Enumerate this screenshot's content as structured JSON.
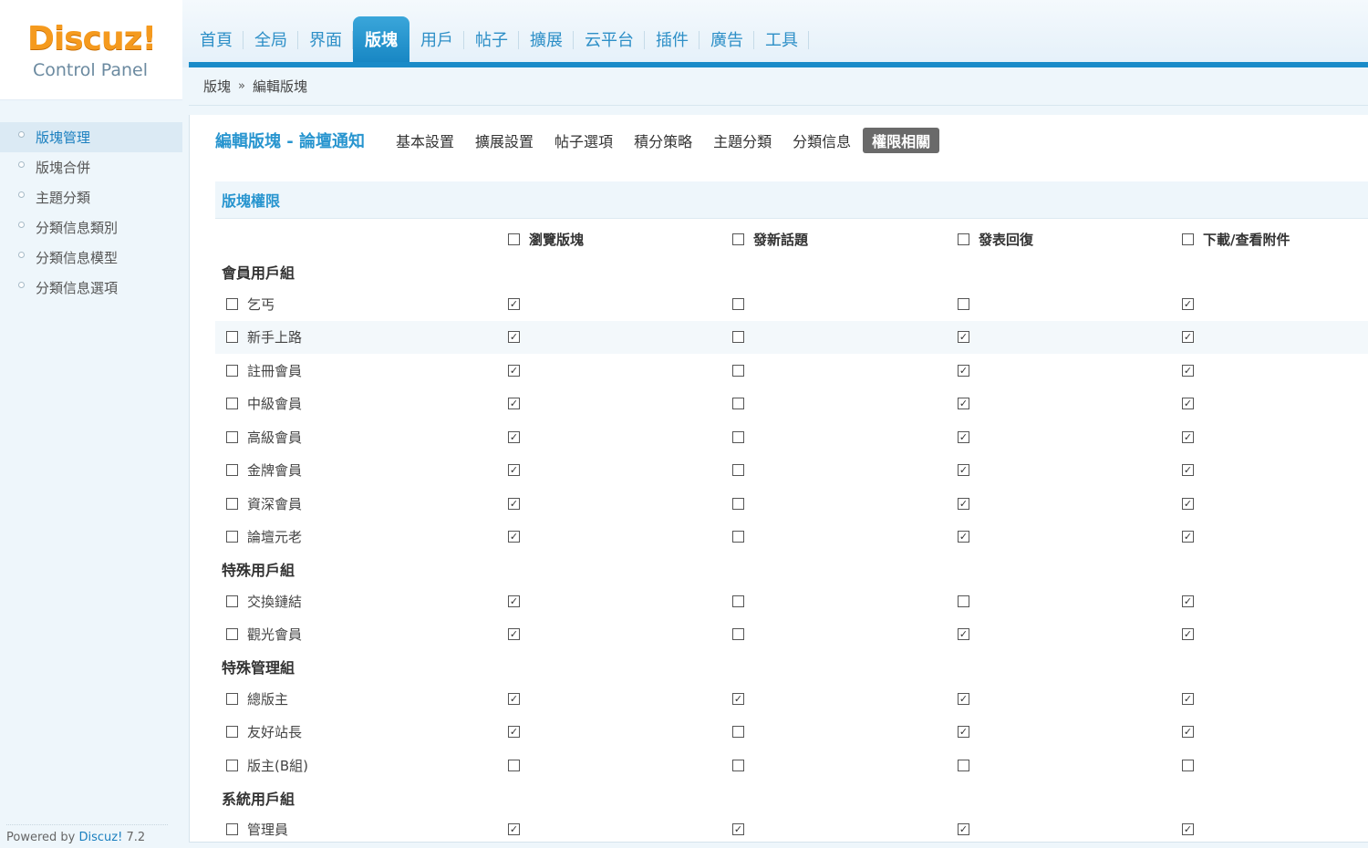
{
  "logo": {
    "word": "Discuz!",
    "sub": "Control Panel"
  },
  "nav": [
    {
      "label": "首頁",
      "active": false
    },
    {
      "label": "全局",
      "active": false
    },
    {
      "label": "界面",
      "active": false
    },
    {
      "label": "版塊",
      "active": true
    },
    {
      "label": "用戶",
      "active": false
    },
    {
      "label": "帖子",
      "active": false
    },
    {
      "label": "擴展",
      "active": false
    },
    {
      "label": "云平台",
      "active": false
    },
    {
      "label": "插件",
      "active": false
    },
    {
      "label": "廣告",
      "active": false
    },
    {
      "label": "工具",
      "active": false
    }
  ],
  "breadcrumb": {
    "root": "版塊",
    "separator": "»",
    "current": "編輯版塊"
  },
  "sidebar": {
    "items": [
      {
        "label": "版塊管理",
        "active": true
      },
      {
        "label": "版塊合併",
        "active": false
      },
      {
        "label": "主題分類",
        "active": false
      },
      {
        "label": "分類信息類別",
        "active": false
      },
      {
        "label": "分類信息模型",
        "active": false
      },
      {
        "label": "分類信息選項",
        "active": false
      }
    ],
    "powered_prefix": "Powered by",
    "powered_brand": "Discuz!",
    "powered_version": "7.2"
  },
  "page": {
    "title": "編輯版塊 - 論壇通知",
    "subtabs": [
      {
        "label": "基本設置",
        "active": false
      },
      {
        "label": "擴展設置",
        "active": false
      },
      {
        "label": "帖子選項",
        "active": false
      },
      {
        "label": "積分策略",
        "active": false
      },
      {
        "label": "主題分類",
        "active": false
      },
      {
        "label": "分類信息",
        "active": false
      },
      {
        "label": "權限相關",
        "active": true
      }
    ],
    "section_title": "版塊權限"
  },
  "columns": [
    "瀏覽版塊",
    "發新話題",
    "發表回復",
    "下載/查看附件"
  ],
  "groups": [
    {
      "label": "會員用戶組",
      "rows": [
        {
          "name": "乞丐",
          "perms": [
            true,
            false,
            false,
            true
          ]
        },
        {
          "name": "新手上路",
          "perms": [
            true,
            false,
            true,
            true
          ],
          "highlight": true
        },
        {
          "name": "註冊會員",
          "perms": [
            true,
            false,
            true,
            true
          ]
        },
        {
          "name": "中級會員",
          "perms": [
            true,
            false,
            true,
            true
          ]
        },
        {
          "name": "高級會員",
          "perms": [
            true,
            false,
            true,
            true
          ]
        },
        {
          "name": "金牌會員",
          "perms": [
            true,
            false,
            true,
            true
          ]
        },
        {
          "name": "資深會員",
          "perms": [
            true,
            false,
            true,
            true
          ]
        },
        {
          "name": "論壇元老",
          "perms": [
            true,
            false,
            true,
            true
          ]
        }
      ]
    },
    {
      "label": "特殊用戶組",
      "rows": [
        {
          "name": "交換鏈結",
          "perms": [
            true,
            false,
            false,
            true
          ]
        },
        {
          "name": "觀光會員",
          "perms": [
            true,
            false,
            true,
            true
          ]
        }
      ]
    },
    {
      "label": "特殊管理組",
      "rows": [
        {
          "name": "總版主",
          "perms": [
            true,
            true,
            true,
            true
          ]
        },
        {
          "name": "友好站長",
          "perms": [
            true,
            false,
            true,
            true
          ]
        },
        {
          "name": "版主(B組)",
          "perms": [
            false,
            false,
            false,
            false
          ]
        }
      ]
    },
    {
      "label": "系統用戶組",
      "rows": [
        {
          "name": "管理員",
          "perms": [
            true,
            true,
            true,
            true
          ]
        }
      ]
    }
  ]
}
